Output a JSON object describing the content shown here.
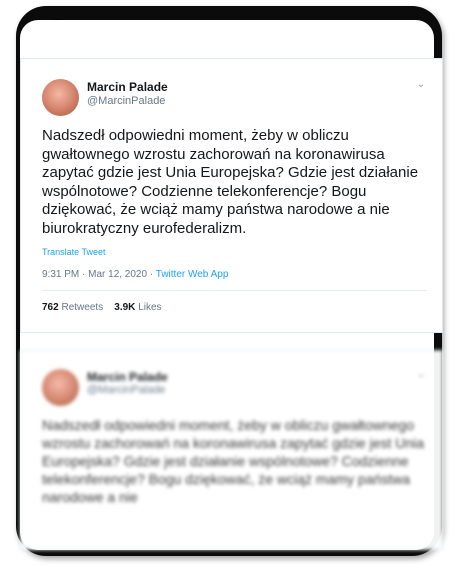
{
  "tweet": {
    "author_name": "Marcin Palade",
    "handle": "@MarcinPalade",
    "text": "Nadszedł odpowiedni moment, żeby w obliczu gwałtownego wzrostu zachorowań na koronawirusa zapytać gdzie jest Unia Europejska? Gdzie jest działanie wspólnotowe? Codzienne telekonferencje? Bogu dziękować, że wciąż mamy państwa narodowe a nie biurokratyczny eurofederalizm.",
    "translate_label": "Translate Tweet",
    "time": "9:31 PM · Mar 12, 2020 · ",
    "source": "Twitter Web App",
    "retweets_count": "762",
    "retweets_label": "Retweets",
    "likes_count": "3.9K",
    "likes_label": "Likes"
  },
  "blurred_tweet": {
    "author_name": "Marcin Palade",
    "handle": "@MarcinPalade",
    "text": "Nadszedł odpowiedni moment, żeby w obliczu gwałtownego wzrostu zachorowań na koronawirusa zapytać gdzie jest Unia Europejska? Gdzie jest działanie wspólnotowe? Codzienne telekonferencje? Bogu dziękować, że wciąż mamy państwa narodowe a nie"
  },
  "icons": {
    "chevron": "chevron-down-icon",
    "camera": "camera-icon"
  },
  "colors": {
    "link": "#1da1f2",
    "text": "#14171a",
    "muted": "#657786",
    "frame": "#0b0b0b"
  }
}
